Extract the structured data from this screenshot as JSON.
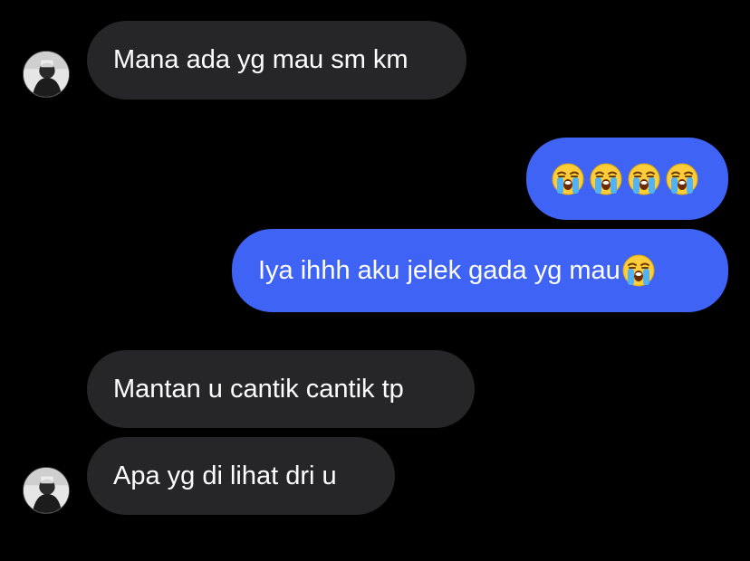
{
  "conversation": {
    "messages": [
      {
        "direction": "incoming",
        "text": "Mana ada yg mau sm km"
      },
      {
        "direction": "outgoing",
        "emojis": [
          "loudly-crying-face-icon",
          "loudly-crying-face-icon",
          "loudly-crying-face-icon",
          "loudly-crying-face-icon"
        ]
      },
      {
        "direction": "outgoing",
        "text": "Iya ihhh aku jelek gada yg mau",
        "trailing_emoji": "loudly-crying-face-icon"
      },
      {
        "direction": "incoming",
        "text": "Mantan u cantik cantik tp"
      },
      {
        "direction": "incoming",
        "text": "Apa yg di lihat dri u"
      }
    ]
  },
  "colors": {
    "background": "#000000",
    "incoming_bubble": "#262628",
    "outgoing_bubble": "#3e63f5",
    "text": "#ffffff"
  }
}
